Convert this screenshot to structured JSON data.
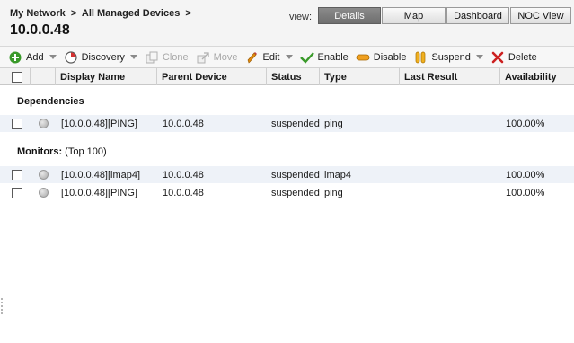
{
  "header": {
    "breadcrumb": [
      "My Network",
      ">",
      "All Managed Devices",
      ">"
    ],
    "title": "10.0.0.48",
    "view_label": "view:",
    "view_tabs": [
      {
        "label": "Details",
        "active": true
      },
      {
        "label": "Map",
        "active": false
      },
      {
        "label": "Dashboard",
        "active": false
      },
      {
        "label": "NOC View",
        "active": false
      }
    ]
  },
  "toolbar": {
    "add": "Add",
    "discovery": "Discovery",
    "clone": "Clone",
    "move": "Move",
    "edit": "Edit",
    "enable": "Enable",
    "disable": "Disable",
    "suspend": "Suspend",
    "delete": "Delete"
  },
  "columns": {
    "display_name": "Display Name",
    "parent_device": "Parent Device",
    "status": "Status",
    "type": "Type",
    "last_result": "Last Result",
    "availability": "Availability"
  },
  "dependencies": {
    "label": "Dependencies",
    "rows": [
      {
        "name": "[10.0.0.48][PING]",
        "parent": "10.0.0.48",
        "status": "suspended",
        "type": "ping",
        "last_result": "",
        "availability": "100.00%"
      }
    ]
  },
  "monitors": {
    "label": "Monitors:",
    "suffix": "(Top 100)",
    "rows": [
      {
        "name": "[10.0.0.48][imap4]",
        "parent": "10.0.0.48",
        "status": "suspended",
        "type": "imap4",
        "last_result": "",
        "availability": "100.00%"
      },
      {
        "name": "[10.0.0.48][PING]",
        "parent": "10.0.0.48",
        "status": "suspended",
        "type": "ping",
        "last_result": "",
        "availability": "100.00%"
      }
    ]
  },
  "colors": {
    "row_stripe": "#eef2f8",
    "active_tab": "#7a7a7a",
    "add_icon": "#3a9a2a",
    "enable_icon": "#3a9a2a",
    "delete_icon": "#cc2020",
    "discovery_icon": "#d43030",
    "edit_icon": "#e08a10"
  },
  "icons": [
    "add-icon",
    "discovery-icon",
    "clone-icon",
    "move-icon",
    "edit-icon",
    "enable-icon",
    "disable-icon",
    "suspend-icon",
    "delete-icon",
    "status-dot-icon"
  ]
}
